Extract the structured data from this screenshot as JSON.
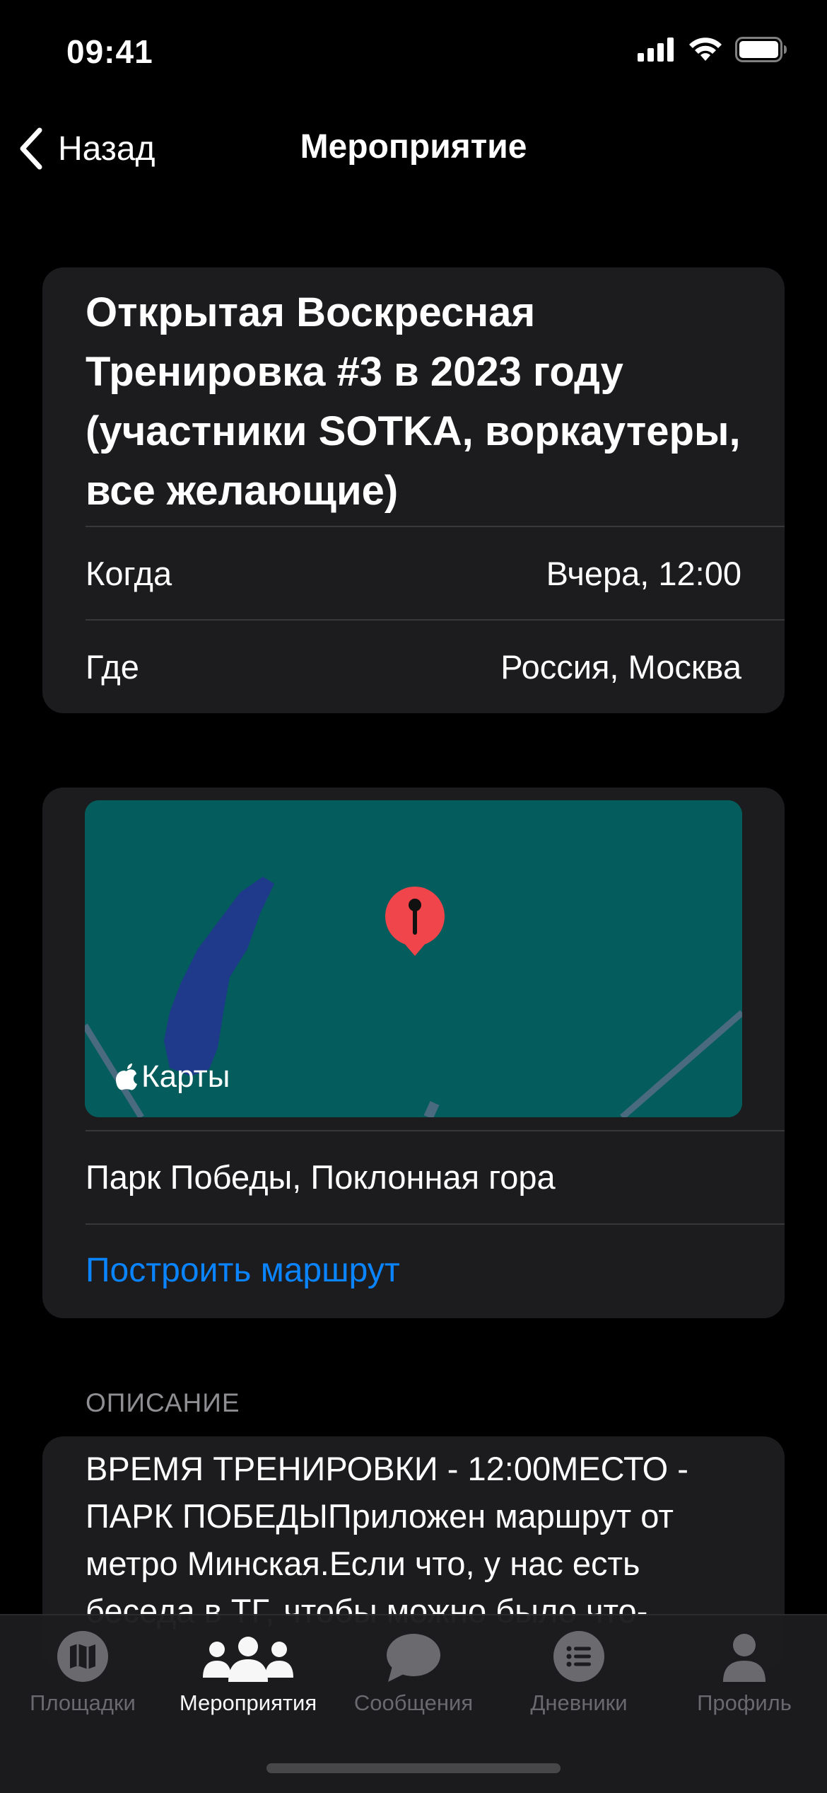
{
  "status_bar": {
    "time": "09:41"
  },
  "nav": {
    "back_label": "Назад",
    "title": "Мероприятие"
  },
  "event": {
    "title": "Открытая Воскресная Тренировка  #3 в 2023 году (участники SOTKA, воркаутеры, все желающие)",
    "when_label": "Когда",
    "when_value": "Вчера, 12:00",
    "where_label": "Где",
    "where_value": "Россия, Москва"
  },
  "map": {
    "provider_label": "Карты",
    "place": "Парк Победы, Поклонная гора",
    "route_button": "Построить маршрут",
    "colors": {
      "water": "#045c5c",
      "park": "#1f3a8a",
      "pin": "#f0454a",
      "road": "#4a6a80"
    }
  },
  "description": {
    "header": "ОПИСАНИЕ",
    "text": "ВРЕМЯ ТРЕНИРОВКИ - 12:00МЕСТО - ПАРК ПОБЕДЫПриложен маршрут от метро Минская.Если что, у нас есть беседа в ТГ, чтобы можно было что-"
  },
  "tab_bar": {
    "tabs": [
      {
        "label": "Площадки",
        "icon": "map-icon",
        "active": false
      },
      {
        "label": "Мероприятия",
        "icon": "people-icon",
        "active": true
      },
      {
        "label": "Сообщения",
        "icon": "chat-bubble-icon",
        "active": false
      },
      {
        "label": "Дневники",
        "icon": "list-icon",
        "active": false
      },
      {
        "label": "Профиль",
        "icon": "person-icon",
        "active": false
      }
    ]
  },
  "colors": {
    "background": "#000000",
    "card": "#1c1c1e",
    "accent": "#0a84ff",
    "separator": "#38383a"
  }
}
